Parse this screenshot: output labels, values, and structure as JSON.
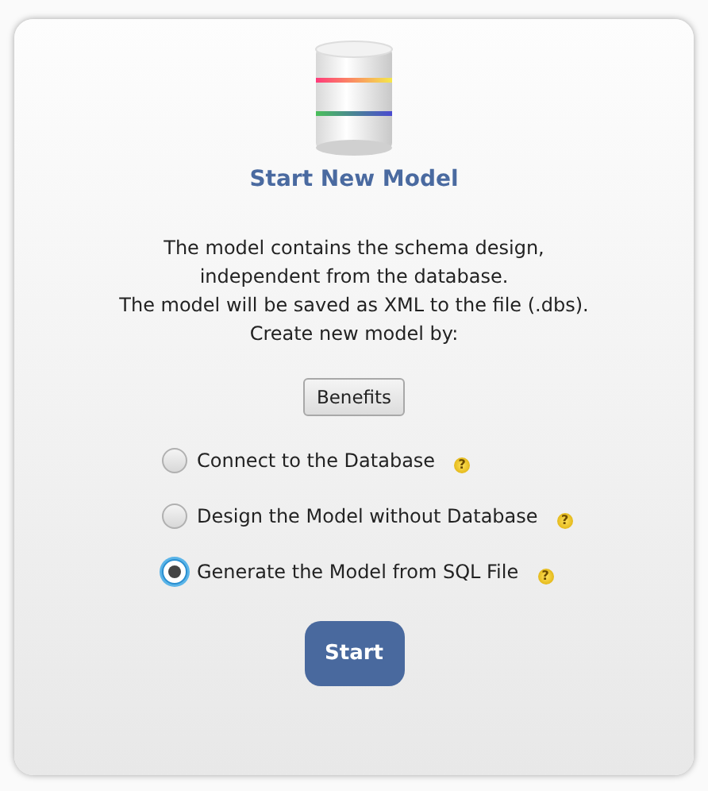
{
  "title": "Start New Model",
  "description": [
    "The model contains the schema design,",
    "independent from the database.",
    "The model will be saved as XML to the file (.dbs).",
    "Create new model by:"
  ],
  "benefits_button": "Benefits",
  "options": [
    {
      "label": "Connect to the Database",
      "help": "?",
      "selected": false
    },
    {
      "label": "Design the Model without Database",
      "help": "?",
      "selected": false
    },
    {
      "label": "Generate the Model from SQL File",
      "help": "?",
      "selected": true
    }
  ],
  "start_button": "Start"
}
